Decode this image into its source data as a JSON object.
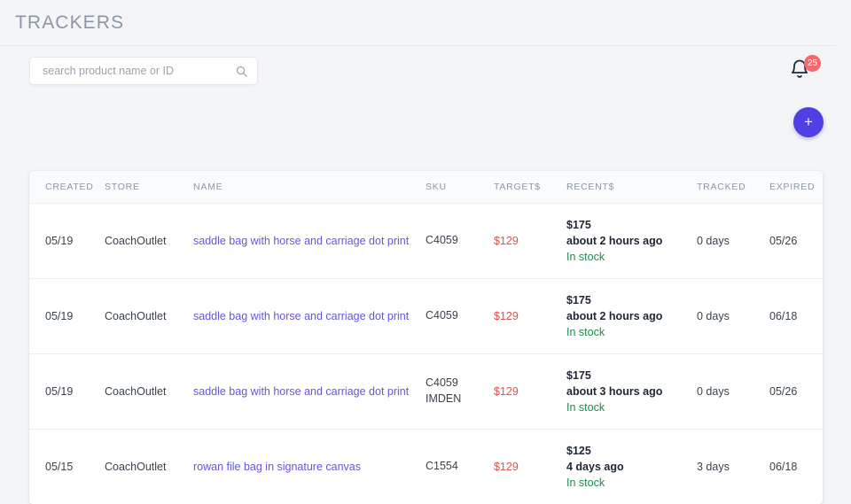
{
  "header": {
    "title": "TRACKERS"
  },
  "toolbar": {
    "search": {
      "placeholder": "search product name or ID",
      "value": "",
      "icon": "search-icon"
    },
    "notifications": {
      "icon": "bell-icon",
      "badge_count": "25",
      "badge_color": "#f4696e"
    },
    "add_button": {
      "label": "+",
      "icon": "plus-icon",
      "color": "#4f40e3"
    }
  },
  "table": {
    "columns": [
      "CREATED",
      "STORE",
      "NAME",
      "SKU",
      "TARGET$",
      "RECENT$",
      "TRACKED",
      "EXPIRED"
    ],
    "rows": [
      {
        "created": "05/19",
        "store": "CoachOutlet",
        "name": "saddle bag with horse and carriage dot print",
        "sku": "C4059",
        "sku_line2": "",
        "target": "$129",
        "recent_price": "$175",
        "recent_time": "about 2 hours ago",
        "recent_stock": "In stock",
        "tracked": "0 days",
        "expired": "05/26"
      },
      {
        "created": "05/19",
        "store": "CoachOutlet",
        "name": "saddle bag with horse and carriage dot print",
        "sku": "C4059",
        "sku_line2": "",
        "target": "$129",
        "recent_price": "$175",
        "recent_time": "about 2 hours ago",
        "recent_stock": "In stock",
        "tracked": "0 days",
        "expired": "06/18"
      },
      {
        "created": "05/19",
        "store": "CoachOutlet",
        "name": "saddle bag with horse and carriage dot print",
        "sku": "C4059",
        "sku_line2": "IMDEN",
        "target": "$129",
        "recent_price": "$175",
        "recent_time": "about 3 hours ago",
        "recent_stock": "In stock",
        "tracked": "0 days",
        "expired": "05/26"
      },
      {
        "created": "05/15",
        "store": "CoachOutlet",
        "name": "rowan file bag in signature canvas",
        "sku": "C1554",
        "sku_line2": "",
        "target": "$129",
        "recent_price": "$125",
        "recent_time": "4 days ago",
        "recent_stock": "In stock",
        "tracked": "3 days",
        "expired": "06/18"
      }
    ]
  },
  "colors": {
    "link": "#6257e0",
    "target_price": "#d9534f",
    "in_stock": "#1f8a4c",
    "accent": "#4f40e3",
    "badge": "#f4696e",
    "page_bg": "#f4f5f7"
  }
}
